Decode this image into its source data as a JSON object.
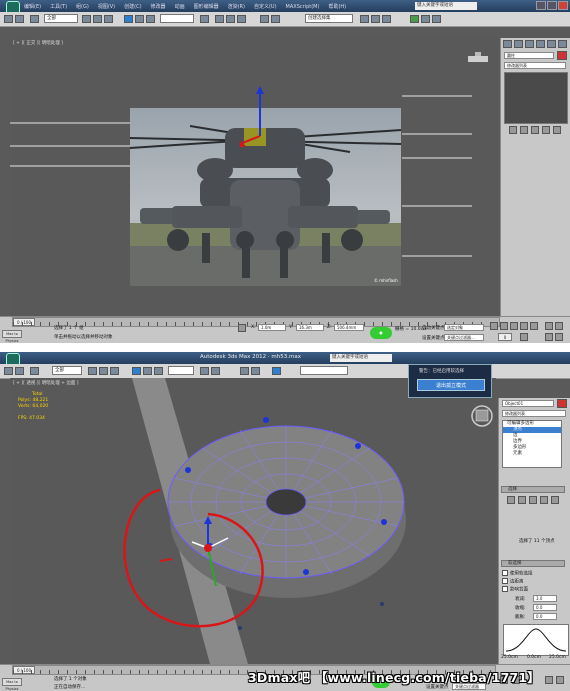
{
  "top": {
    "window_title": "Autodesk 3ds Max 2012 · mh53.max",
    "menu": [
      "编辑(E)",
      "工具(T)",
      "组(G)",
      "视图(V)",
      "创建(C)",
      "修改器",
      "动画",
      "图形编辑器",
      "渲染(R)",
      "自定义(U)",
      "MAXScript(M)",
      "帮助(H)"
    ],
    "search_placeholder": "键入关键字或短语",
    "selection_filter": "全部",
    "named_selection": "创建选择集",
    "viewport_label": "[ + ][ 正交 ][ 明暗处理 ]",
    "modifier_list": "修改器列表",
    "object_name": "圆柱",
    "status_prompt_1": "选择了 1 个 组",
    "status_prompt_2": "单击并拖动以选择并移动对象",
    "x_value": "1.0m",
    "y_value": "16.3m",
    "z_value": "506.4mm",
    "autokey_label": "自动关键点",
    "setkey_label": "设置关键点",
    "selected_dropdown": "选定对象",
    "key_filter": "关键点过滤器...",
    "add_time_tag": "添加时间标记",
    "grid_label": "栅格 = 10.0cm",
    "time_slider": "0 / 100",
    "maxphysics": "Max to Physics",
    "timeline_left": "0",
    "timeline_right": "100"
  },
  "bottom": {
    "window_title": "Autodesk 3ds Max 2012 · mh53.max",
    "search_placeholder": "键入关键字或短语",
    "selection_filter": "全部",
    "viewport_label": "[ + ][ 透视 ][ 明暗处理 + 边面 ]",
    "stats": {
      "total": "Total",
      "polys_label": "Polys:",
      "polys": "48,221",
      "verts_label": "Verts:",
      "verts": "64,020",
      "fps_label": "FPS:",
      "fps": "47.034"
    },
    "object_name": "Object01",
    "modifier_list": "修改器列表",
    "stack_items": [
      "可编辑多边形",
      "顶点",
      "边",
      "边界",
      "多边形",
      "元素"
    ],
    "stack_selected_index": 1,
    "popup_title": "警告：已经启用软选择",
    "popup_button": "退出孤立模式",
    "rollout_selection": "选择",
    "rollout_soft": "软选择",
    "use_soft_selection": "使用软选择",
    "edge_distance": "边距离",
    "affect_backface": "影响背面",
    "falloff_label": "衰减:",
    "falloff_value": "3.0",
    "pinch_label": "收缩:",
    "pinch_value": "0.0",
    "bubble_label": "膨胀:",
    "bubble_value": "0.0",
    "selected_count": "选择了 11 个顶点",
    "shaded_face": "明暗处理面切换",
    "curve_labels": [
      "25.0cm",
      "0.0cm",
      "25.0cm"
    ],
    "status_prompt_1": "选择了 1 个对象",
    "status_prompt_2": "正在自动保存...",
    "time_slider": "0 / 100",
    "maxphysics": "Max to Physics",
    "autokey_label": "自动关键点",
    "setkey_label": "设置关键点",
    "key_filter": "关键点过滤器",
    "add_time_tag": "添加时间标记"
  },
  "watermark": "3Dmax吧 【www.linecg.com/tieba/1771】",
  "colors": {
    "titlebar": "#2f4c72",
    "viewport": "#595959",
    "panel": "#c8c8c8",
    "accent_blue": "#3a7fd0",
    "annotation_red": "#d8161a",
    "wire_blue": "#6a5cff"
  },
  "icons": [
    "app-logo-icon",
    "undo-icon",
    "redo-icon",
    "select-icon",
    "move-icon",
    "rotate-icon",
    "scale-icon",
    "snap-icon",
    "render-icon",
    "lock-icon",
    "play-icon",
    "teapot-icon"
  ]
}
